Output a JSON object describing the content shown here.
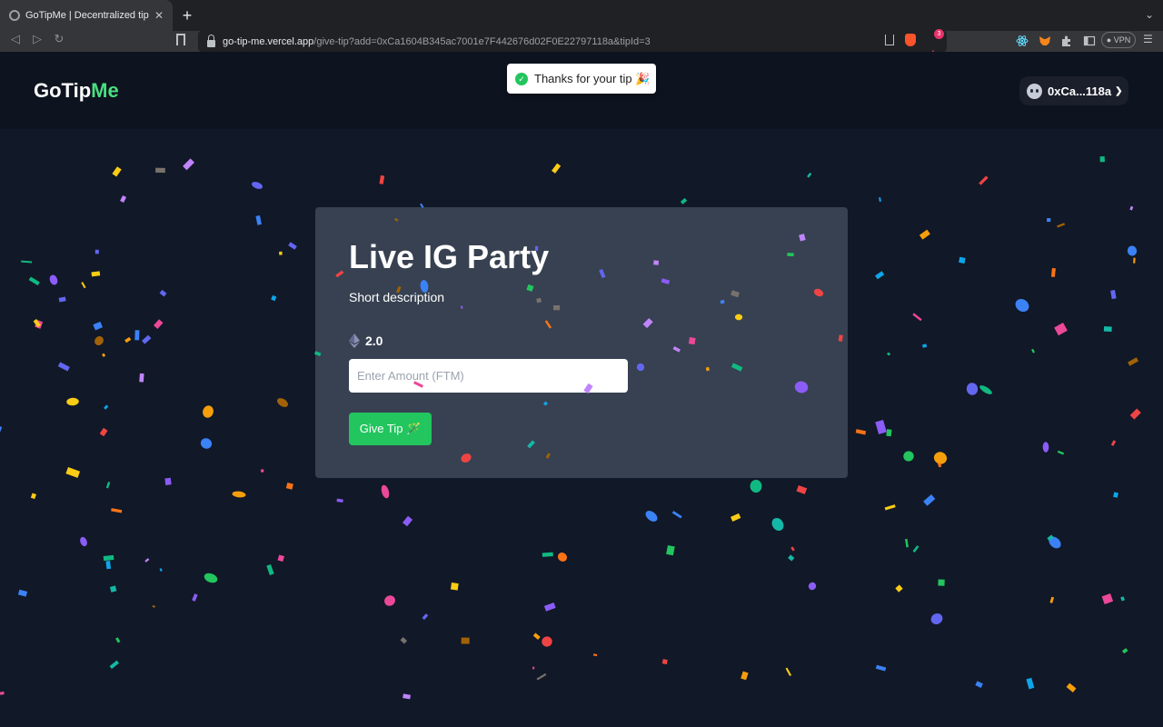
{
  "browser": {
    "tab_title": "GoTipMe | Decentralized tips",
    "url_host": "go-tip-me.vercel.app",
    "url_path": "/give-tip?add=0xCa1604B345ac7001e7F442676d02F0E22797118a&tipId=3",
    "rewards_badge": "3",
    "vpn_label": "VPN"
  },
  "header": {
    "logo_main": "GoTip",
    "logo_accent": "Me",
    "wallet_address": "0xCa...118a"
  },
  "toast": {
    "message": "Thanks for your tip 🎉"
  },
  "card": {
    "title": "Live IG Party",
    "description": "Short description",
    "amount": "2.0",
    "input_placeholder": "Enter Amount (FTM)",
    "button_label": "Give Tip 🪄"
  },
  "colors": {
    "accent": "#4ade80",
    "button": "#22c55e",
    "card_bg": "#374151",
    "page_bg": "#111827"
  }
}
